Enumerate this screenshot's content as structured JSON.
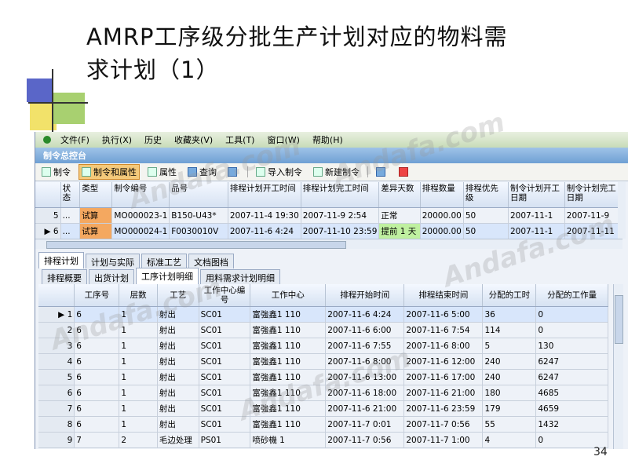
{
  "slide": {
    "title_line1": "AMRP工序级分批生产计划对应的物料需",
    "title_line2": "求计划（1）",
    "page_number": "34",
    "watermark": "Andafa.com"
  },
  "menu": [
    "文件(F)",
    "执行(X)",
    "历史",
    "收藏夹(V)",
    "工具(T)",
    "窗口(W)",
    "帮助(H)"
  ],
  "window_title": "制令总控台",
  "toolbar": [
    "制令",
    "制令和属性",
    "属性",
    "查询",
    "导入制令",
    "新建制令"
  ],
  "grid1": {
    "headers": [
      "",
      "状态",
      "类型",
      "制令编号",
      "品号",
      "排程计划开工时间",
      "排程计划完工时间",
      "差异天数",
      "排程数量",
      "排程优先级",
      "制令计划开工日期",
      "制令计划完工日期"
    ],
    "rows": [
      [
        "5",
        "...",
        "试算",
        "MO000023-1",
        "B150-U43*",
        "2007-11-4 19:30",
        "2007-11-9 2:54",
        "正常",
        "20000.00",
        "50",
        "2007-11-1",
        "2007-11-9"
      ],
      [
        "6",
        "...",
        "试算",
        "MO000024-1",
        "F0030010V",
        "2007-11-6 4:24",
        "2007-11-10 23:59",
        "提前 1 天",
        "20000.00",
        "50",
        "2007-11-1",
        "2007-11-11"
      ]
    ]
  },
  "tabs_main": [
    "排程计划",
    "计划与实际",
    "标准工艺",
    "文档图档"
  ],
  "tabs_sub": [
    "排程概要",
    "出货计划",
    "工序计划明细",
    "用料需求计划明细"
  ],
  "grid2": {
    "headers": [
      "",
      "工序号",
      "层数",
      "工艺",
      "工作中心编号",
      "工作中心",
      "排程开始时间",
      "排程结束时间",
      "分配的工时",
      "分配的工作量"
    ],
    "rows": [
      [
        "1",
        "6",
        "1",
        "射出",
        "SC01",
        "富強鑫1 110",
        "2007-11-6 4:24",
        "2007-11-6 5:00",
        "36",
        "0"
      ],
      [
        "2",
        "6",
        "1",
        "射出",
        "SC01",
        "富強鑫1 110",
        "2007-11-6 6:00",
        "2007-11-6 7:54",
        "114",
        "0"
      ],
      [
        "3",
        "6",
        "1",
        "射出",
        "SC01",
        "富強鑫1 110",
        "2007-11-6 7:55",
        "2007-11-6 8:00",
        "5",
        "130"
      ],
      [
        "4",
        "6",
        "1",
        "射出",
        "SC01",
        "富強鑫1 110",
        "2007-11-6 8:00",
        "2007-11-6 12:00",
        "240",
        "6247"
      ],
      [
        "5",
        "6",
        "1",
        "射出",
        "SC01",
        "富強鑫1 110",
        "2007-11-6 13:00",
        "2007-11-6 17:00",
        "240",
        "6247"
      ],
      [
        "6",
        "6",
        "1",
        "射出",
        "SC01",
        "富強鑫1 110",
        "2007-11-6 18:00",
        "2007-11-6 21:00",
        "180",
        "4685"
      ],
      [
        "7",
        "6",
        "1",
        "射出",
        "SC01",
        "富強鑫1 110",
        "2007-11-6 21:00",
        "2007-11-6 23:59",
        "179",
        "4659"
      ],
      [
        "8",
        "6",
        "1",
        "射出",
        "SC01",
        "富強鑫1 110",
        "2007-11-7 0:01",
        "2007-11-7 0:56",
        "55",
        "1432"
      ],
      [
        "9",
        "7",
        "2",
        "毛边处理",
        "PS01",
        "喷砂機 1",
        "2007-11-7 0:56",
        "2007-11-7 1:00",
        "4",
        "0"
      ]
    ]
  }
}
